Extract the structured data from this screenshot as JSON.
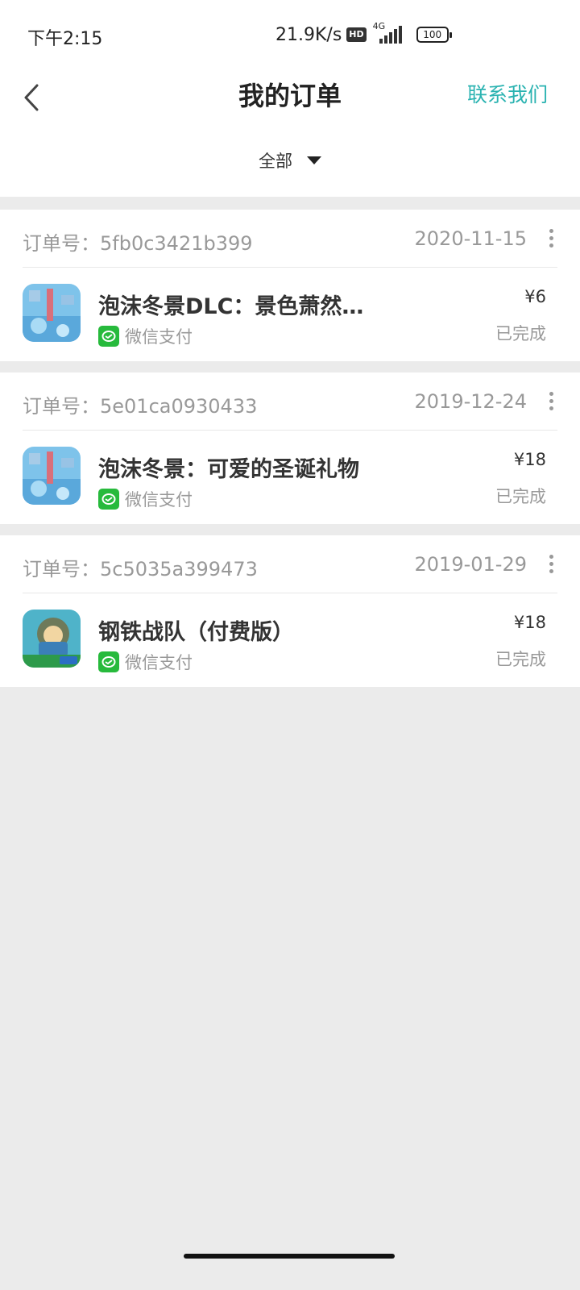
{
  "status_bar": {
    "time": "下午2:15",
    "net_speed": "21.9K/s",
    "hd_badge": "HD",
    "network": "4G",
    "battery": "100"
  },
  "header": {
    "title": "我的订单",
    "contact_label": "联系我们",
    "back_icon": "chevron-left-icon"
  },
  "filter": {
    "selected": "全部"
  },
  "orders": [
    {
      "order_id": "订单号：5fb0c3421b399",
      "date": "2020-11-15",
      "name": "泡沫冬景DLC：景色萧然…",
      "payment": "微信支付",
      "price": "¥6",
      "status": "已完成",
      "icon": "foam-winter-app-icon"
    },
    {
      "order_id": "订单号：5e01ca0930433",
      "date": "2019-12-24",
      "name": "泡沫冬景：可爱的圣诞礼物",
      "payment": "微信支付",
      "price": "¥18",
      "status": "已完成",
      "icon": "foam-winter-app-icon"
    },
    {
      "order_id": "订单号：5c5035a399473",
      "date": "2019-01-29",
      "name": "钢铁战队（付费版）",
      "payment": "微信支付",
      "price": "¥18",
      "status": "已完成",
      "icon": "iron-team-app-icon"
    }
  ],
  "colors": {
    "accent": "#2bb3b1",
    "wechat": "#27ba3c",
    "background": "#ebebeb"
  }
}
